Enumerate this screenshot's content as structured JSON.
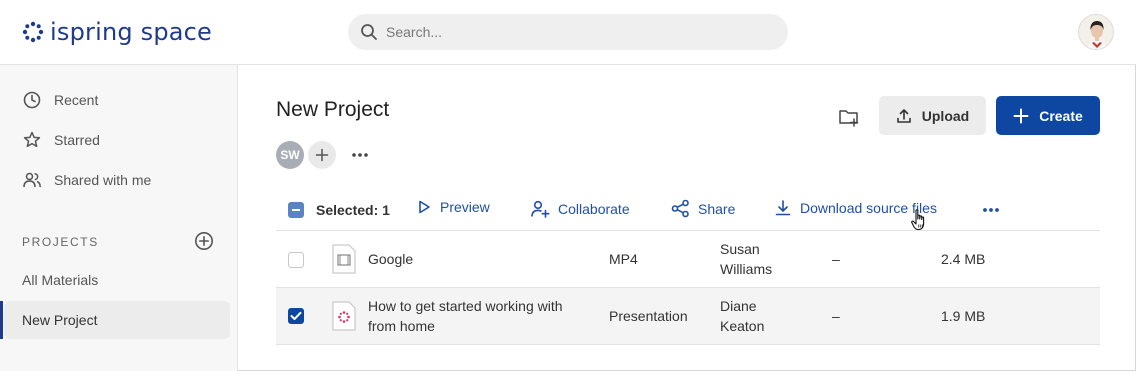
{
  "app": {
    "logo_text": "ispring space"
  },
  "search": {
    "placeholder": "Search..."
  },
  "sidebar": {
    "items": [
      {
        "label": "Recent",
        "icon": "clock-icon"
      },
      {
        "label": "Starred",
        "icon": "star-icon"
      },
      {
        "label": "Shared with me",
        "icon": "people-icon"
      }
    ],
    "projects_label": "PROJECTS",
    "links": [
      {
        "label": "All Materials",
        "active": false
      },
      {
        "label": "New Project",
        "active": true
      }
    ]
  },
  "project": {
    "title": "New Project",
    "member_initials": "SW"
  },
  "toolbar": {
    "upload_label": "Upload",
    "create_label": "Create"
  },
  "actions": {
    "selected_label": "Selected: 1",
    "preview": "Preview",
    "collaborate": "Collaborate",
    "share": "Share",
    "download": "Download source files"
  },
  "files": [
    {
      "name": "Google",
      "type": "MP4",
      "author_first": "Susan",
      "author_last": "Williams",
      "modified": "–",
      "size": "2.4 MB",
      "checked": false,
      "icon": "video-file-icon"
    },
    {
      "name_line1": "How to get started working with",
      "name_line2": "from home",
      "type": "Presentation",
      "author_first": "Diane",
      "author_last": "Keaton",
      "modified": "–",
      "size": "1.9 MB",
      "checked": true,
      "icon": "ispring-file-icon"
    }
  ],
  "colors": {
    "brand": "#1f3b8f",
    "primary_button": "#0d47a1",
    "link": "#1f4fa8"
  }
}
